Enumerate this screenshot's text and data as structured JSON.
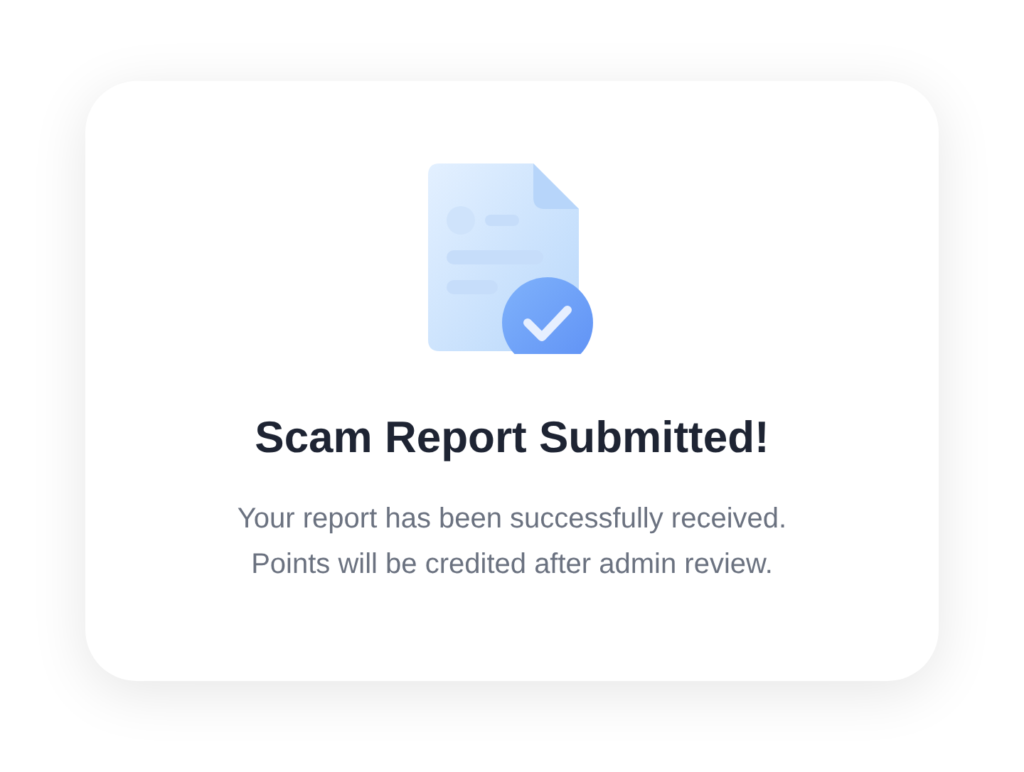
{
  "dialog": {
    "title": "Scam Report Submitted!",
    "message": [
      "Your report has been successfully received.",
      "Points will be credited after admin review."
    ]
  }
}
